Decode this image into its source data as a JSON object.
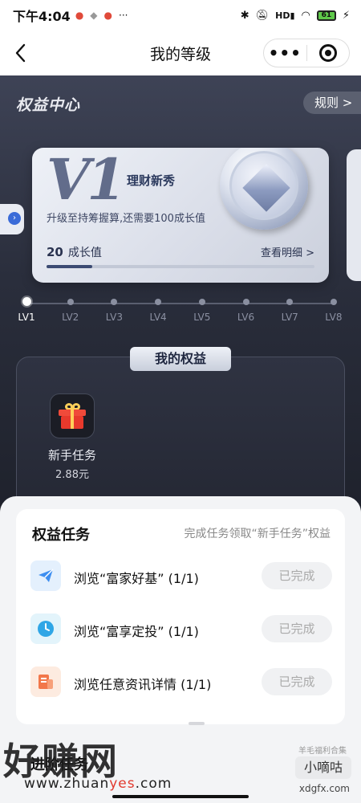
{
  "status_bar": {
    "time": "下午4:04",
    "notification_dots": "•",
    "more": "···",
    "icons": [
      "bluetooth-icon",
      "mute-icon",
      "hd-signal-icon",
      "wifi-icon"
    ],
    "battery": "61"
  },
  "nav": {
    "back_icon": "chevron-left-icon",
    "title": "我的等级",
    "more_label": "•••",
    "close_icon": "target-icon"
  },
  "hero": {
    "title": "权益中心",
    "rules": "规则 >"
  },
  "level_card": {
    "level": "V1",
    "level_name": "理财新秀",
    "description": "升级至持筹握算,还需要100成长值",
    "growth_value": "20",
    "growth_unit": "成长值",
    "detail_link": "查看明细 >",
    "progress": 0.17
  },
  "levels": [
    "LV1",
    "LV2",
    "LV3",
    "LV4",
    "LV5",
    "LV6",
    "LV7",
    "LV8"
  ],
  "current_level_index": 0,
  "rights": {
    "tab_label": "我的权益",
    "items": [
      {
        "name": "新手任务",
        "value": "2.88元",
        "icon": "gift-icon"
      }
    ]
  },
  "tasks": {
    "title": "权益任务",
    "hint": "完成任务领取“新手任务”权益",
    "items": [
      {
        "label": "浏览“富家好基” (1/1)",
        "button": "已完成",
        "icon": "paper-plane-icon"
      },
      {
        "label": "浏览“富享定投” (1/1)",
        "button": "已完成",
        "icon": "clock-icon"
      },
      {
        "label": "浏览任意资讯详情 (1/1)",
        "button": "已完成",
        "icon": "document-icon"
      }
    ]
  },
  "next_section": "进阶任务",
  "watermark": {
    "big": "好赚网",
    "url_prefix": "www.zhuan",
    "url_mid": "yes",
    "url_suffix": ".com",
    "badge_top": "羊毛福利合集",
    "badge": "小嘀咕",
    "site": "xdgfx.com"
  },
  "colors": {
    "accent_blue": "#3a6bd8",
    "gift_red": "#e8392c",
    "done_bg": "#f0f1f3"
  }
}
